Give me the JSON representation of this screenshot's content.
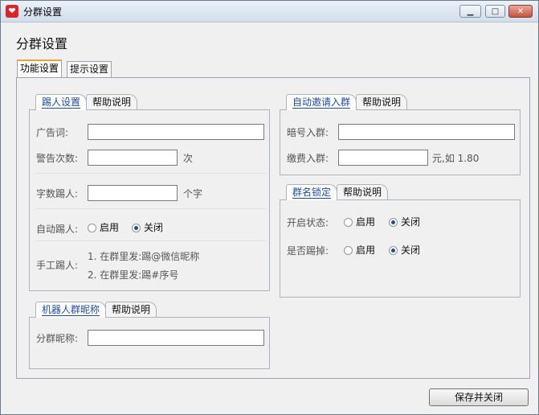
{
  "window": {
    "title": "分群设置",
    "app_icon": "heart-logo-icon",
    "controls": {
      "minimize": "▁",
      "maximize": "□",
      "close": "✕"
    }
  },
  "page_title": "分群设置",
  "tabs": [
    {
      "label": "功能设置",
      "active": true
    },
    {
      "label": "提示设置",
      "active": false
    }
  ],
  "kick_group": {
    "tabs": [
      "踢人设置",
      "帮助说明"
    ],
    "ad_words_label": "广告词:",
    "ad_words_value": "",
    "warn_count_label": "警告次数:",
    "warn_count_value": "",
    "warn_count_unit": "次",
    "char_kick_label": "字数踢人:",
    "char_kick_value": "",
    "char_kick_unit": "个字",
    "auto_kick_label": "自动踢人:",
    "auto_kick_options": {
      "enable": "启用",
      "disable": "关闭",
      "selected": "disable"
    },
    "manual_kick_label": "手工踢人:",
    "manual_kick_hints": [
      "1. 在群里发:踢@微信昵称",
      "2. 在群里发:踢#序号"
    ]
  },
  "bot_nick_group": {
    "tabs": [
      "机器人群昵称",
      "帮助说明"
    ],
    "nick_label": "分群昵称:",
    "nick_value": ""
  },
  "invite_group": {
    "tabs": [
      "自动邀请入群",
      "帮助说明"
    ],
    "password_label": "暗号入群:",
    "password_value": "",
    "fee_label": "缴费入群:",
    "fee_value": "",
    "fee_unit": "元,如 1.80"
  },
  "lock_group": {
    "tabs": [
      "群名锁定",
      "帮助说明"
    ],
    "status_label": "开启状态:",
    "status_options": {
      "enable": "启用",
      "disable": "关闭",
      "selected": "disable"
    },
    "kick_label": "是否踢掉:",
    "kick_options": {
      "enable": "启用",
      "disable": "关闭",
      "selected": "disable"
    }
  },
  "footer": {
    "save_close_label": "保存并关闭"
  }
}
